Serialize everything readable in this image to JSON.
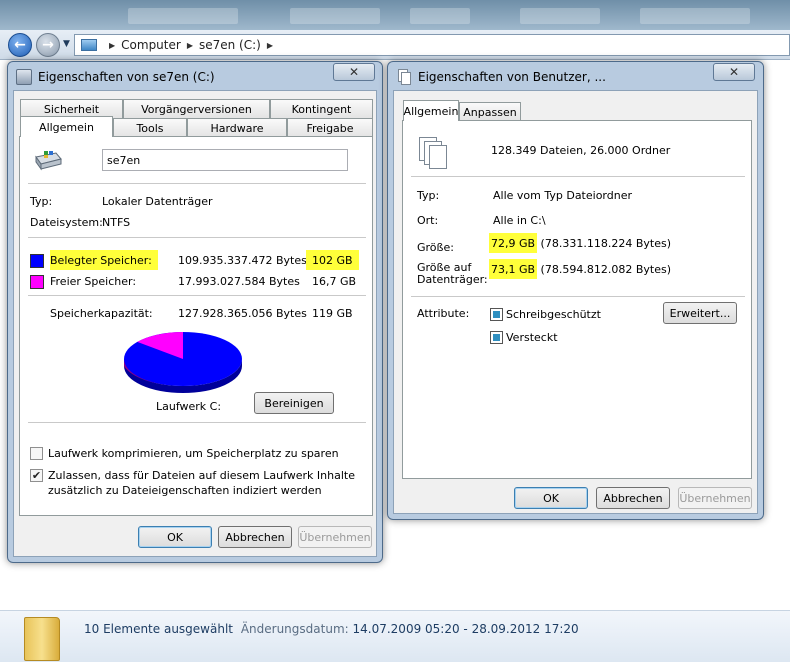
{
  "explorer": {
    "address": {
      "segments": [
        "Computer",
        "se7en (C:)"
      ]
    },
    "status": {
      "selection": "10 Elemente ausgewählt",
      "date_label": "Änderungsdatum:",
      "date_value": "14.07.2009 05:20 - 28.09.2012 17:20"
    }
  },
  "left_dialog": {
    "title": "Eigenschaften von se7en (C:)",
    "close_label": "✕",
    "tabs_row1": [
      "Sicherheit",
      "Vorgängerversionen",
      "Kontingent"
    ],
    "tabs_row2": [
      "Allgemein",
      "Tools",
      "Hardware",
      "Freigabe"
    ],
    "drive_name": "se7en",
    "type_label": "Typ:",
    "type_value": "Lokaler Datenträger",
    "fs_label": "Dateisystem:",
    "fs_value": "NTFS",
    "used_label": "Belegter Speicher:",
    "used_bytes": "109.935.337.472 Bytes",
    "used_gb": "102 GB",
    "free_label": "Freier Speicher:",
    "free_bytes": "17.993.027.584 Bytes",
    "free_gb": "16,7 GB",
    "capacity_label": "Speicherkapazität:",
    "capacity_bytes": "127.928.365.056 Bytes",
    "capacity_gb": "119 GB",
    "drive_label": "Laufwerk C:",
    "cleanup_button": "Bereinigen",
    "compress_label": "Laufwerk komprimieren, um Speicherplatz zu sparen",
    "index_label_line1": "Zulassen, dass für Dateien auf diesem Laufwerk Inhalte",
    "index_label_line2": "zusätzlich zu Dateieigenschaften indiziert werden",
    "compress_checked": false,
    "index_checked": true,
    "ok_button": "OK",
    "cancel_button": "Abbrechen",
    "apply_button": "Übernehmen",
    "colors": {
      "used": "#0000ff",
      "free": "#ff00ff"
    },
    "used_fraction": 0.859
  },
  "right_dialog": {
    "title": "Eigenschaften von Benutzer, ...",
    "close_label": "✕",
    "tabs": [
      "Allgemein",
      "Anpassen"
    ],
    "summary": "128.349 Dateien, 26.000 Ordner",
    "type_label": "Typ:",
    "type_value": "Alle vom Typ Dateiordner",
    "location_label": "Ort:",
    "location_value": "Alle in C:\\",
    "size_label": "Größe:",
    "size_gb": "72,9 GB",
    "size_bytes": " (78.331.118.224 Bytes)",
    "ondisk_label_line1": "Größe auf",
    "ondisk_label_line2": "Datenträger:",
    "ondisk_gb": "73,1 GB",
    "ondisk_bytes": " (78.594.812.082 Bytes)",
    "attributes_label": "Attribute:",
    "readonly_label": "Schreibgeschützt",
    "hidden_label": "Versteckt",
    "advanced_button": "Erweitert...",
    "ok_button": "OK",
    "cancel_button": "Abbrechen",
    "apply_button": "Übernehmen"
  }
}
